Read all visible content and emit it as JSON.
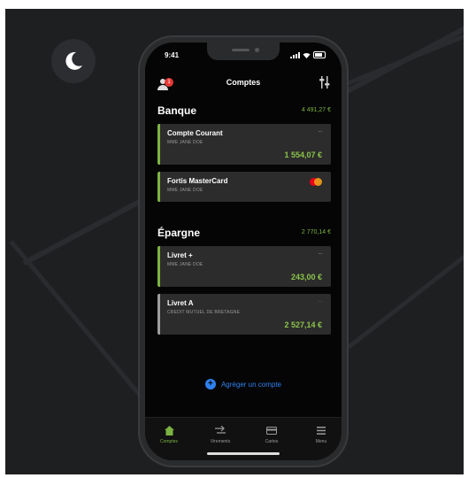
{
  "status_bar": {
    "time": "9:41"
  },
  "nav": {
    "title": "Comptes",
    "badge": "1"
  },
  "sections": [
    {
      "name": "Banque",
      "total": "4 491,27 €",
      "accounts": [
        {
          "name": "Compte Courant",
          "holder": "MME JANE DOE",
          "amount": "1 554,07 €",
          "accent": "#7cb342"
        },
        {
          "name": "Fortis MasterCard",
          "holder": "MME JANE DOE",
          "amount": "",
          "accent": "#7cb342"
        }
      ]
    },
    {
      "name": "Épargne",
      "total": "2 770,14 €",
      "accounts": [
        {
          "name": "Livret +",
          "holder": "MME JANE DOE",
          "amount": "243,00 €",
          "accent": "#7cb342"
        },
        {
          "name": "Livret A",
          "holder": "CREDIT MUTUEL DE BRETAGNE",
          "amount": "2 527,14 €",
          "accent": "#9e9e9e"
        }
      ]
    }
  ],
  "aggregate_label": "Agréger un compte",
  "tabs": [
    {
      "label": "Comptes",
      "icon": "home-icon",
      "active": true
    },
    {
      "label": "Virements",
      "icon": "transfer-icon",
      "active": false
    },
    {
      "label": "Cartes",
      "icon": "card-icon",
      "active": false
    },
    {
      "label": "Menu",
      "icon": "menu-icon",
      "active": false
    }
  ],
  "colors": {
    "accent_green": "#7cb342",
    "link_blue": "#2f80ed",
    "badge_red": "#e53935"
  }
}
